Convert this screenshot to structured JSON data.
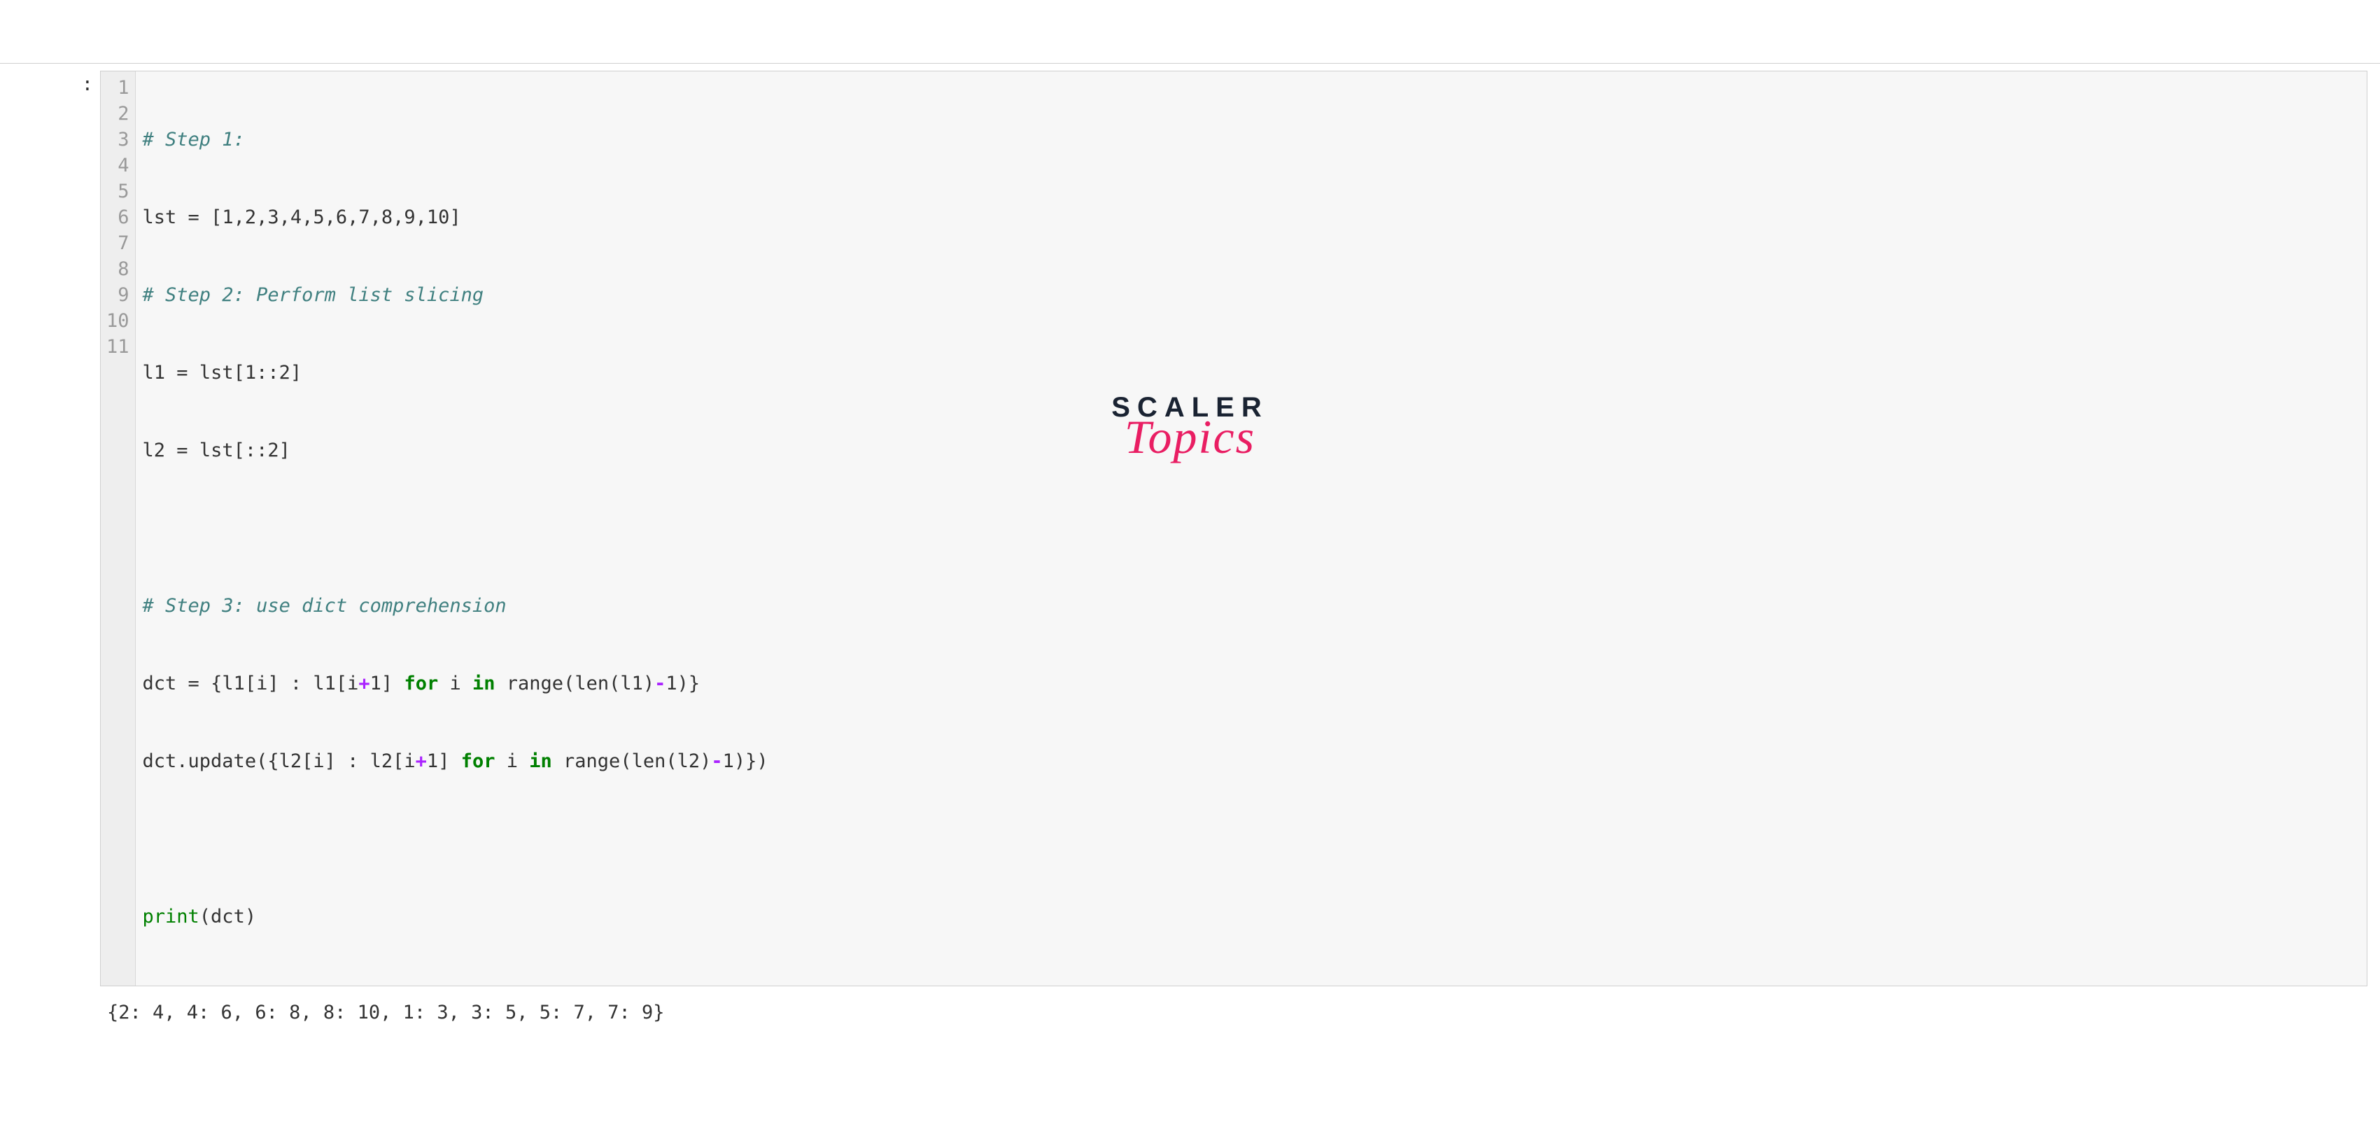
{
  "prompt": ":",
  "line_numbers": [
    "1",
    "2",
    "3",
    "4",
    "5",
    "6",
    "7",
    "8",
    "9",
    "10",
    "11"
  ],
  "code": {
    "line1": {
      "comment": "# Step 1:"
    },
    "line2": {
      "var": "lst",
      "values": "[1,2,3,4,5,6,7,8,9,10]"
    },
    "line3": {
      "comment": "# Step 2: Perform list slicing"
    },
    "line4": {
      "var": "l1",
      "expr": "lst[1::2]"
    },
    "line5": {
      "var": "l2",
      "expr": "lst[::2]"
    },
    "line6": "",
    "line7": {
      "comment": "# Step 3: use dict comprehension"
    },
    "line8": {
      "var": "dct",
      "l1a": "{l1[i] : l1[i",
      "plus": "+",
      "l1b": "1]",
      "kw_for": "for",
      "mid": " i ",
      "kw_in": "in",
      "tail1": " range(len(l1)",
      "minus": "-",
      "tail2": "1)}"
    },
    "line9": {
      "pre": "dct.update({l2[i] : l2[i",
      "plus": "+",
      "l1b": "1]",
      "kw_for": "for",
      "mid": " i ",
      "kw_in": "in",
      "tail1": " range(len(l2)",
      "minus": "-",
      "tail2": "1)})"
    },
    "line10": "",
    "line11": {
      "fn": "print",
      "arg": "(dct)"
    }
  },
  "output": "{2: 4, 4: 6, 6: 8, 8: 10, 1: 3, 3: 5, 5: 7, 7: 9}",
  "logo": {
    "main": "SCALER",
    "sub": "Topics"
  }
}
